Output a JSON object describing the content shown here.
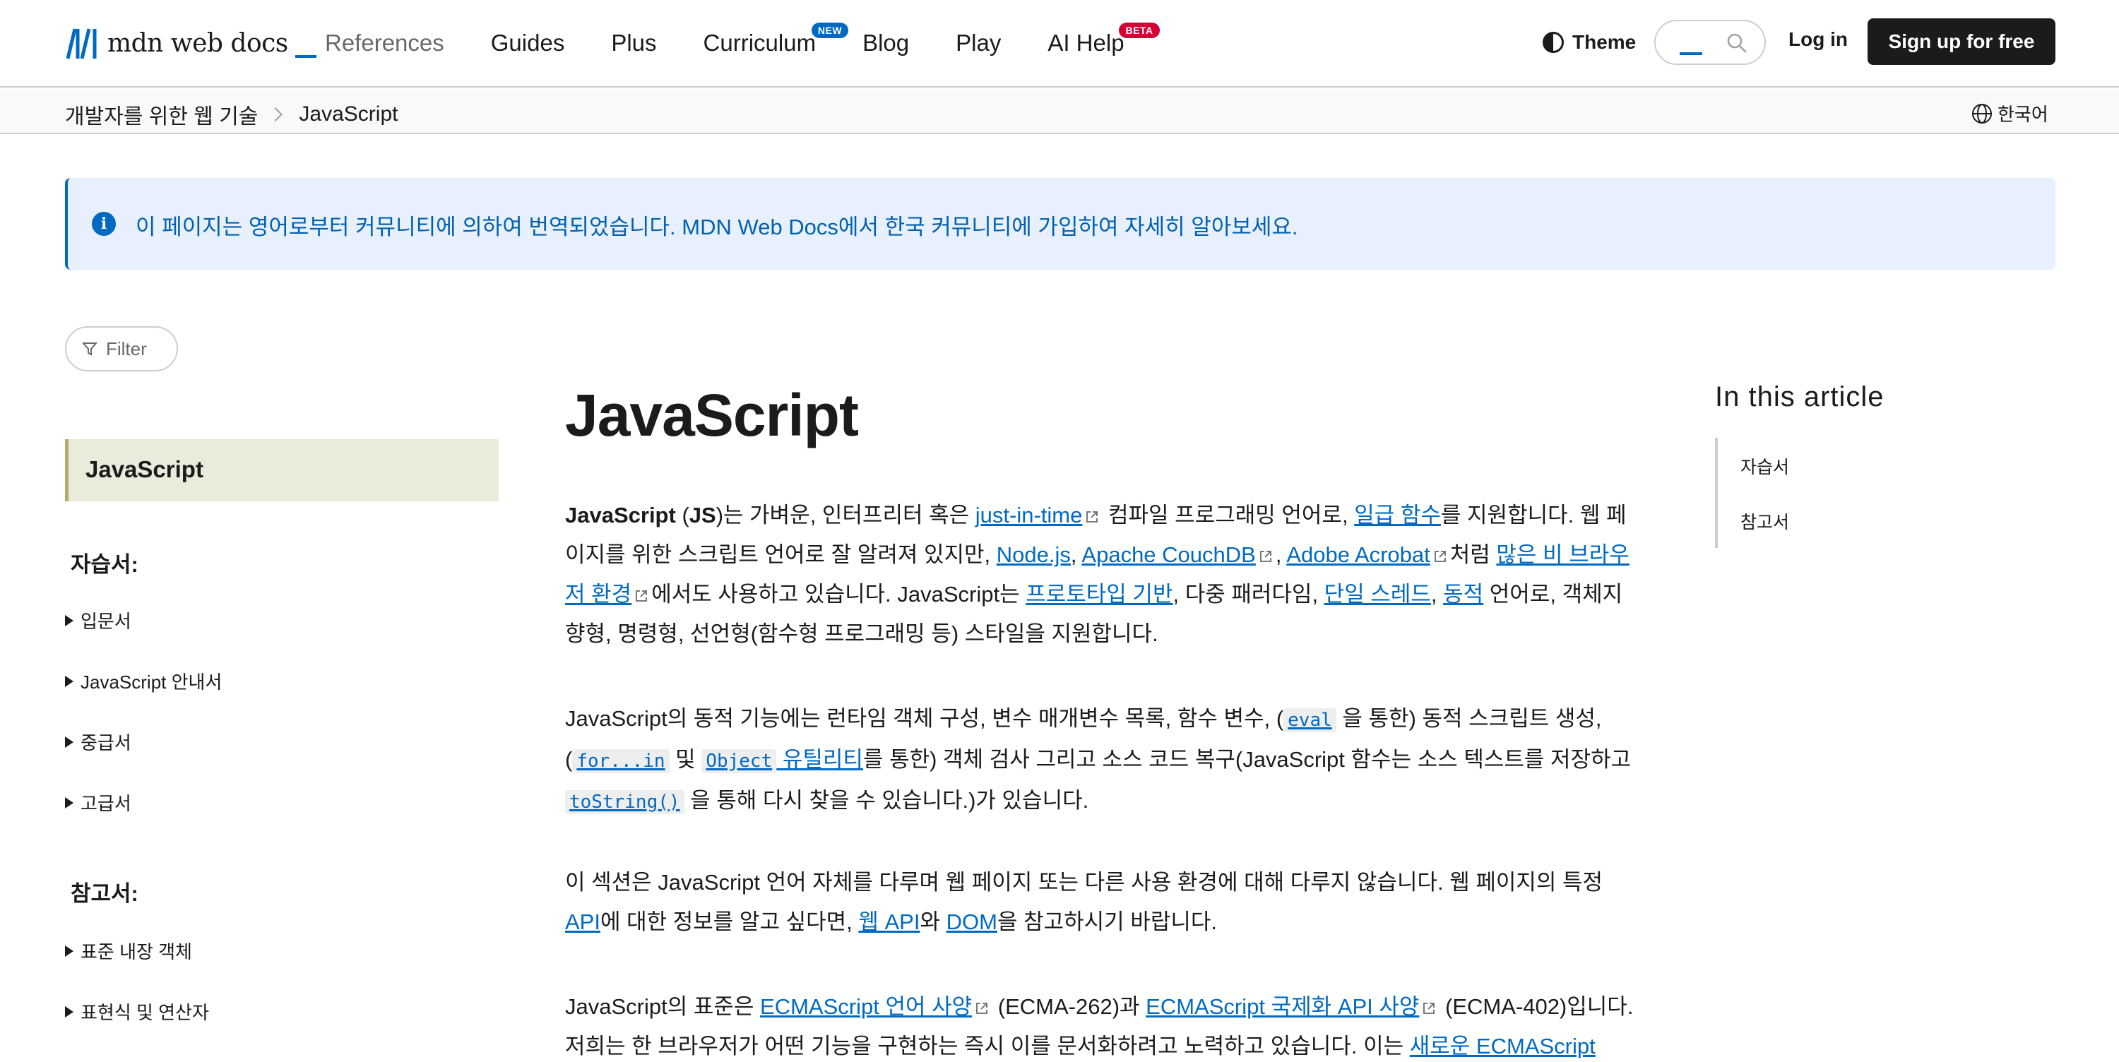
{
  "nav": {
    "logo_text": "mdn web docs",
    "items": [
      {
        "label": "References",
        "badge": ""
      },
      {
        "label": "Guides",
        "badge": ""
      },
      {
        "label": "Plus",
        "badge": ""
      },
      {
        "label": "Curriculum",
        "badge": "NEW"
      },
      {
        "label": "Blog",
        "badge": ""
      },
      {
        "label": "Play",
        "badge": ""
      },
      {
        "label": "AI Help",
        "badge": "BETA"
      }
    ],
    "theme_label": "Theme",
    "login_label": "Log in",
    "signup_label": "Sign up for free"
  },
  "breadcrumb": {
    "items": [
      "개발자를 위한 웹 기술",
      "JavaScript"
    ],
    "language": "한국어"
  },
  "notice": {
    "text": "이 페이지는 영어로부터 커뮤니티에 의하여 번역되었습니다. MDN Web Docs에서 한국 커뮤니티에 가입하여 자세히 알아보세요."
  },
  "sidebar": {
    "filter_label": "Filter",
    "active_item": "JavaScript",
    "sections": [
      {
        "heading": "자습서:",
        "items": [
          "입문서",
          "JavaScript 안내서",
          "중급서",
          "고급서"
        ]
      },
      {
        "heading": "참고서:",
        "items": [
          "표준 내장 객체",
          "표현식 및 연산자"
        ]
      }
    ]
  },
  "article": {
    "title": "JavaScript",
    "p1": {
      "bold": "JavaScript",
      "abbr": "JS",
      "t1": ")는 가벼운, 인터프리터 혹은 ",
      "link_jit": "just-in-time",
      "t2": " 컴파일 프로그래밍 언어로, ",
      "link_first_class": "일급 함수",
      "t3": "를 지원합니다. 웹 페이지를 위한 스크립트 언어로 잘 알려져 있지만, ",
      "link_node": "Node.js",
      "link_couch": "Apache CouchDB",
      "link_acrobat": "Adobe Acrobat",
      "t4": "처럼 ",
      "link_nonbrowser": "많은 비 브라우저 환경",
      "t5": "에서도 사용하고 있습니다. JavaScript는 ",
      "link_prototype": "프로토타입 기반",
      "t6": ", 다중 패러다임, ",
      "link_single_thread": "단일 스레드",
      "link_dynamic": "동적",
      "t7": " 언어로, 객체지향형, 명령형, 선언형(함수형 프로그래밍 등) 스타일을 지원합니다."
    },
    "p2": {
      "t1": "JavaScript의 동적 기능에는 런타임 객체 구성, 변수 매개변수 목록, 함수 변수, (",
      "code_eval": "eval",
      "t2": " 을 통한) 동적 스크립트 생성, (",
      "code_forin": "for...in",
      "t3": " 및 ",
      "code_object": "Object",
      "link_utils": " 유틸리티",
      "t4": "를 통한) 객체 검사 그리고 소스 코드 복구(JavaScript 함수는 소스 텍스트를 저장하고 ",
      "code_tostring": "toString()",
      "t5": " 을 통해 다시 찾을 수 있습니다.)가 있습니다."
    },
    "p3": {
      "t1": "이 섹션은 JavaScript 언어 자체를 다루며 웹 페이지 또는 다른 사용 환경에 대해 다루지 않습니다. 웹 페이지의 특정 ",
      "link_api": "API",
      "t2": "에 대한 정보를 알고 싶다면, ",
      "link_webapi": "웹 API",
      "t3": "와 ",
      "link_dom": "DOM",
      "t4": "을 참고하시기 바랍니다."
    },
    "p4": {
      "t1": "JavaScript의 표준은 ",
      "link_ecma262": "ECMAScript 언어 사양",
      "t2": " (ECMA-262)과 ",
      "link_ecma402": "ECMAScript 국제화 API 사양",
      "t3": " (ECMA-402)입니다. 저희는 한 브라우저가 어떤 기능을 구현하는 즉시 이를 문서화하려고 노력하고 있습니다. 이는 ",
      "link_new": "새로운 ECMAScript"
    }
  },
  "toc": {
    "title": "In this article",
    "items": [
      "자습서",
      "참고서"
    ]
  },
  "colors": {
    "link": "#0069c2",
    "notice_bg": "#e8f0fd",
    "sidebar_active_bg": "#ebebdb",
    "signup_bg": "#1b1b1b"
  }
}
